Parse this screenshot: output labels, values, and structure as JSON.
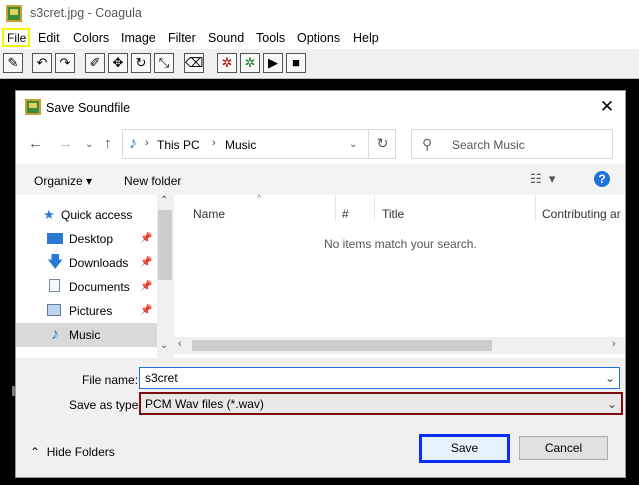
{
  "app": {
    "title": "s3cret.jpg - Coagula",
    "menu": [
      "File",
      "Edit",
      "Colors",
      "Image",
      "Filter",
      "Sound",
      "Tools",
      "Options",
      "Help"
    ]
  },
  "dialog": {
    "title": "Save Soundfile",
    "breadcrumb": [
      "This PC",
      "Music"
    ],
    "search_placeholder": "Search Music",
    "organize_label": "Organize",
    "new_folder_label": "New folder",
    "help_label": "?",
    "nav_items": [
      {
        "label": "Quick access",
        "icon": "star-icon"
      },
      {
        "label": "Desktop",
        "icon": "desktop-icon",
        "pinned": true
      },
      {
        "label": "Downloads",
        "icon": "download-icon",
        "pinned": true
      },
      {
        "label": "Documents",
        "icon": "documents-icon",
        "pinned": true
      },
      {
        "label": "Pictures",
        "icon": "pictures-icon",
        "pinned": true
      },
      {
        "label": "Music",
        "icon": "music-icon",
        "selected": true
      }
    ],
    "columns": [
      "Name",
      "#",
      "Title",
      "Contributing ar"
    ],
    "empty_message": "No items match your search.",
    "file_name_label": "File name:",
    "file_name_value": "s3cret",
    "save_type_label": "Save as type:",
    "save_type_value": "PCM Wav files (*.wav)",
    "hide_folders_label": "Hide Folders",
    "save_label": "Save",
    "cancel_label": "Cancel"
  },
  "colors": {
    "highlight_file": "#f5f500",
    "save_focus": "#0a2ef5",
    "savetype_border": "#7b0d0d",
    "accent": "#1f6fdc"
  }
}
